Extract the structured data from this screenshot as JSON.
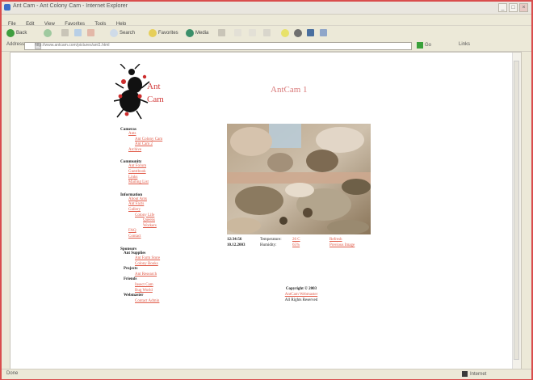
{
  "window": {
    "title": "Ant Cam - Ant Colony Cam - Internet Explorer",
    "controls": [
      "_",
      "□",
      "×"
    ]
  },
  "menu": [
    "File",
    "Edit",
    "View",
    "Favorites",
    "Tools",
    "Help"
  ],
  "toolbar": {
    "back_label": "Back",
    "search_label": "Search",
    "favorites_label": "Favorites",
    "media_label": "Media"
  },
  "address": {
    "label": "Address",
    "url": "http://www.antcam.com/pictures/ant1.html",
    "go_label": "Go",
    "links_label": "Links"
  },
  "logo": {
    "word1": "Ant",
    "word2": "Cam"
  },
  "page": {
    "title": "AntCam 1"
  },
  "nav": {
    "sections": [
      {
        "title": "Cameras",
        "items": [
          {
            "label": "Ants",
            "level": 1
          },
          {
            "label": "Ant Colony Cam",
            "level": 2
          },
          {
            "label": "Ant Cam 2",
            "level": 2
          },
          {
            "label": "Archive",
            "level": 1
          }
        ]
      },
      {
        "title": "Community",
        "items": [
          {
            "label": "Ant Forum",
            "level": 1
          },
          {
            "label": "Guestbook",
            "level": 1
          },
          {
            "label": "Links",
            "level": 1
          },
          {
            "label": "Mailing List",
            "level": 1
          }
        ]
      },
      {
        "title": "Information",
        "items": [
          {
            "label": "About Ants",
            "level": 1
          },
          {
            "label": "Ant Facts",
            "level": 1
          },
          {
            "label": "Gallery",
            "level": 1
          },
          {
            "label": "Colony Life",
            "level": 2
          },
          {
            "label": "Queens",
            "level": 2
          },
          {
            "label": "Workers",
            "level": 2
          },
          {
            "label": "FAQ",
            "level": 1
          },
          {
            "label": "Contact",
            "level": 1
          }
        ]
      },
      {
        "title": "Sponsors",
        "groups": [
          {
            "name": "Ant Supplies",
            "items": [
              "Ant Farm Store",
              "Colony Books"
            ]
          },
          {
            "name": "Projects",
            "items": [
              "Ant Research"
            ]
          },
          {
            "name": "Friends",
            "items": [
              "Insect Cam",
              "Bug World"
            ]
          },
          {
            "name": "Webmaster",
            "items": [
              "Contact Admin"
            ]
          }
        ]
      }
    ]
  },
  "photo_caption": {
    "rows": [
      [
        "12:34:56",
        "Temperature:",
        "26 C",
        "Refresh"
      ],
      [
        "10.12.2003",
        "Humidity:",
        "65%",
        "Previous Image"
      ]
    ]
  },
  "footer": {
    "copyright": "Copyright © 2003",
    "link": "AntCam Webmaster",
    "rights": "All Rights Reserved"
  },
  "status": {
    "left": "Done",
    "right": "Internet"
  },
  "colors": {
    "accent": "#e05a48",
    "window_border": "#d94d4d"
  }
}
